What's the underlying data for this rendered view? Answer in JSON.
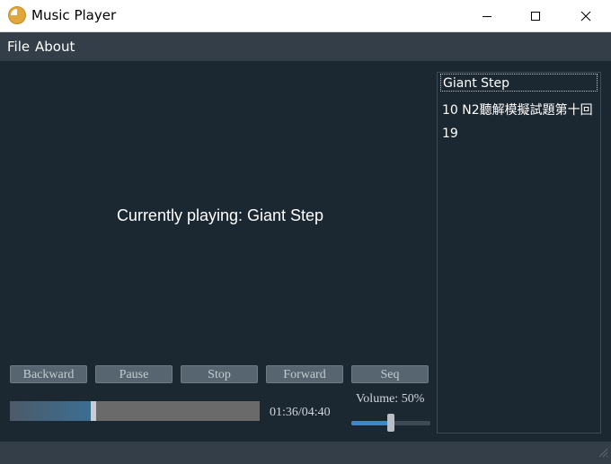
{
  "window": {
    "title": "Music Player"
  },
  "menu": {
    "items": [
      {
        "label": "File"
      },
      {
        "label": "About"
      }
    ]
  },
  "player": {
    "now_playing": "Currently playing: Giant Step",
    "controls": [
      {
        "label": "Backward"
      },
      {
        "label": "Pause"
      },
      {
        "label": "Stop"
      },
      {
        "label": "Forward"
      },
      {
        "label": "Seq"
      }
    ],
    "progress": {
      "fraction": 0.333,
      "time": "01:36/04:40"
    },
    "volume": {
      "label": "Volume: 50%",
      "fraction": 0.5
    }
  },
  "playlist": {
    "items": [
      {
        "label": "Giant Step",
        "selected": true
      },
      {
        "label": "10 N2聽解模擬試題第十回",
        "selected": false
      },
      {
        "label": "19",
        "selected": false
      }
    ]
  },
  "colors": {
    "background": "#1b2731",
    "menubar": "#333e48",
    "accent": "#3f86c8",
    "button": "#56656f"
  }
}
